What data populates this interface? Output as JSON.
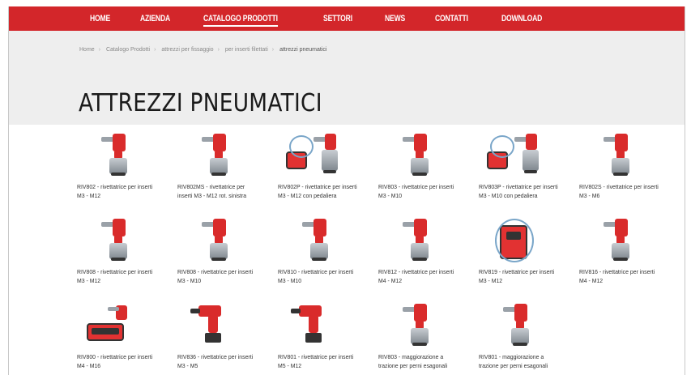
{
  "nav": {
    "items": [
      {
        "label": "HOME",
        "active": false
      },
      {
        "label": "AZIENDA",
        "active": false
      },
      {
        "label": "CATALOGO PRODOTTI",
        "active": true
      },
      {
        "label": "SETTORI",
        "active": false
      },
      {
        "label": "NEWS",
        "active": false
      },
      {
        "label": "CONTATTI",
        "active": false
      },
      {
        "label": "DOWNLOAD",
        "active": false
      }
    ],
    "bar_color": "#d3262a"
  },
  "breadcrumb": {
    "items": [
      "Home",
      "Catalogo Prodotti",
      "attrezzi per fissaggio",
      "per inserti filettati",
      "attrezzi pneumatici"
    ]
  },
  "page": {
    "title": "ATTREZZI PNEUMATICI"
  },
  "products": [
    {
      "caption": "RIV802 - rivettatrice per inserti M3 - M12",
      "icon": "pneumatic-riveter-icon"
    },
    {
      "caption": "RIV802MS - rivettatrice per inserti M3 - M12 rot. sinistra",
      "icon": "pneumatic-riveter-icon"
    },
    {
      "caption": "RIV802P - rivettatrice per inserti M3 - M12 con pedaliera",
      "icon": "riveter-with-pedal-icon"
    },
    {
      "caption": "RIV803 - rivettatrice per inserti M3 - M10",
      "icon": "pneumatic-riveter-icon"
    },
    {
      "caption": "RIV803P - rivettatrice per inserti M3 - M10 con pedaliera",
      "icon": "riveter-with-pedal-icon"
    },
    {
      "caption": "RIV802S - rivettatrice per inserti M3 - M6",
      "icon": "pneumatic-riveter-icon"
    },
    {
      "caption": "RIV808 - rivettatrice per inserti M3 - M12",
      "icon": "pneumatic-riveter-icon"
    },
    {
      "caption": "RIV808 - rivettatrice per inserti M3 - M10",
      "icon": "pneumatic-riveter-icon"
    },
    {
      "caption": "RIV810 - rivettatrice per inserti M3 - M10",
      "icon": "pneumatic-riveter-icon"
    },
    {
      "caption": "RIV812 - rivettatrice per inserti M4 - M12",
      "icon": "pneumatic-riveter-icon"
    },
    {
      "caption": "RIV819 - rivettatrice per inserti M3 - M12",
      "icon": "control-box-riveter-icon"
    },
    {
      "caption": "RIV816 - rivettatrice per inserti M4 - M12",
      "icon": "pneumatic-riveter-icon"
    },
    {
      "caption": "RIV800 - rivettatrice per inserti M4 - M16",
      "icon": "hydraulic-unit-icon"
    },
    {
      "caption": "RIV836 - rivettatrice per inserti M3 - M5",
      "icon": "battery-riveter-icon"
    },
    {
      "caption": "RIV801 - rivettatrice per inserti M5 - M12",
      "icon": "battery-riveter-icon"
    },
    {
      "caption": "RIV803 - maggiorazione a trazione per perni esagonali",
      "icon": "pneumatic-riveter-icon"
    },
    {
      "caption": "RIV801 - maggiorazione a trazione per perni esagonali",
      "icon": "pneumatic-riveter-icon"
    }
  ]
}
